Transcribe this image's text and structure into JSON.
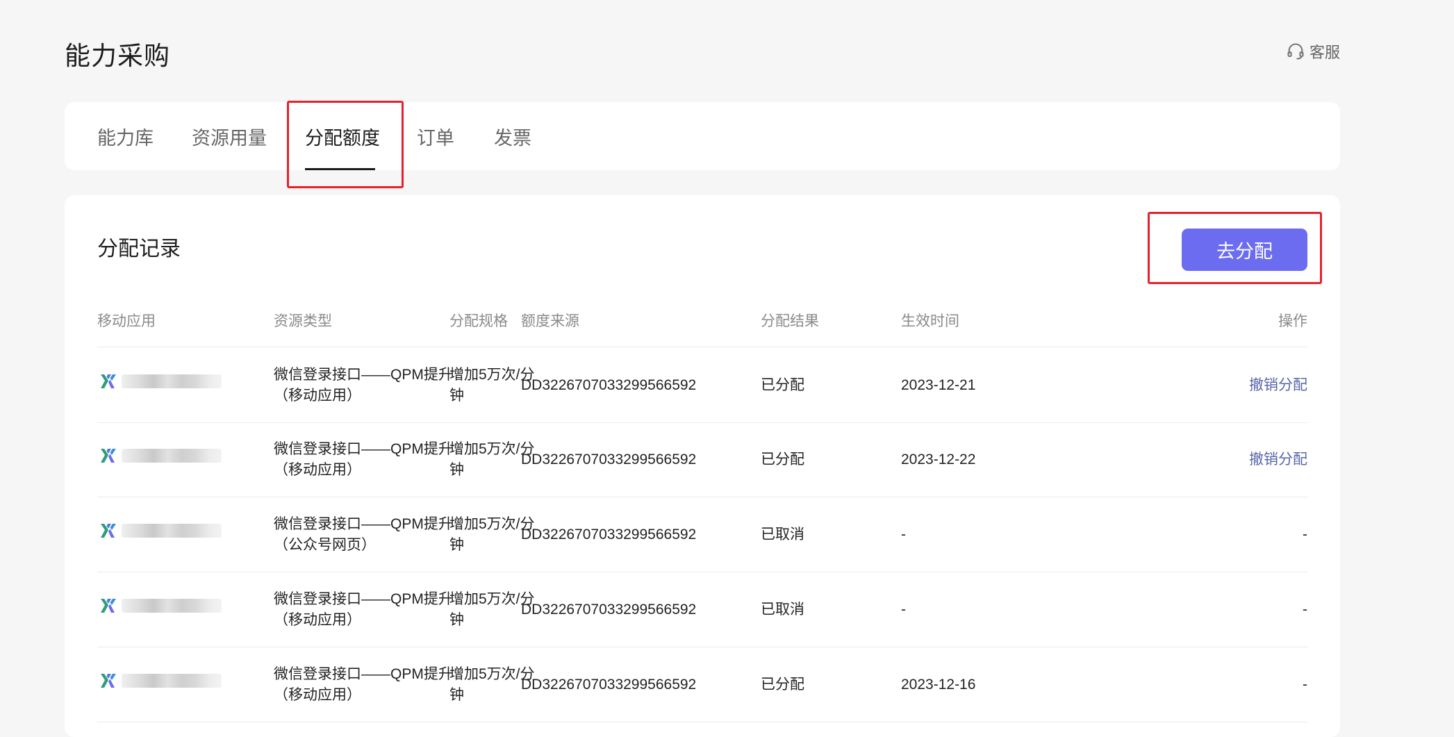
{
  "header": {
    "title": "能力采购",
    "service_label": "客服"
  },
  "tabs": [
    {
      "label": "能力库"
    },
    {
      "label": "资源用量"
    },
    {
      "label": "分配额度"
    },
    {
      "label": "订单"
    },
    {
      "label": "发票"
    }
  ],
  "active_tab": "分配额度",
  "section": {
    "title": "分配记录",
    "allocate_button": "去分配"
  },
  "table": {
    "columns": [
      "移动应用",
      "资源类型",
      "分配规格",
      "额度来源",
      "分配结果",
      "生效时间",
      "操作"
    ],
    "rows": [
      {
        "type_line1": "微信登录接口——QPM提升",
        "type_line2": "（移动应用）",
        "spec_line1": "增加5万次/分",
        "spec_line2": "钟",
        "source": "DD3226707033299566592",
        "result": "已分配",
        "time": "2023-12-21",
        "action": "撤销分配"
      },
      {
        "type_line1": "微信登录接口——QPM提升",
        "type_line2": "（移动应用）",
        "spec_line1": "增加5万次/分",
        "spec_line2": "钟",
        "source": "DD3226707033299566592",
        "result": "已分配",
        "time": "2023-12-22",
        "action": "撤销分配"
      },
      {
        "type_line1": "微信登录接口——QPM提升",
        "type_line2": "（公众号网页）",
        "spec_line1": "增加5万次/分",
        "spec_line2": "钟",
        "source": "DD3226707033299566592",
        "result": "已取消",
        "time": "-",
        "action": "-"
      },
      {
        "type_line1": "微信登录接口——QPM提升",
        "type_line2": "（移动应用）",
        "spec_line1": "增加5万次/分",
        "spec_line2": "钟",
        "source": "DD3226707033299566592",
        "result": "已取消",
        "time": "-",
        "action": "-"
      },
      {
        "type_line1": "微信登录接口——QPM提升",
        "type_line2": "（移动应用）",
        "spec_line1": "增加5万次/分",
        "spec_line2": "钟",
        "source": "DD3226707033299566592",
        "result": "已分配",
        "time": "2023-12-16",
        "action": "-"
      }
    ]
  },
  "colors": {
    "accent": "#6b6cf0",
    "link": "#5866a8",
    "highlight_box": "#e8202a"
  }
}
